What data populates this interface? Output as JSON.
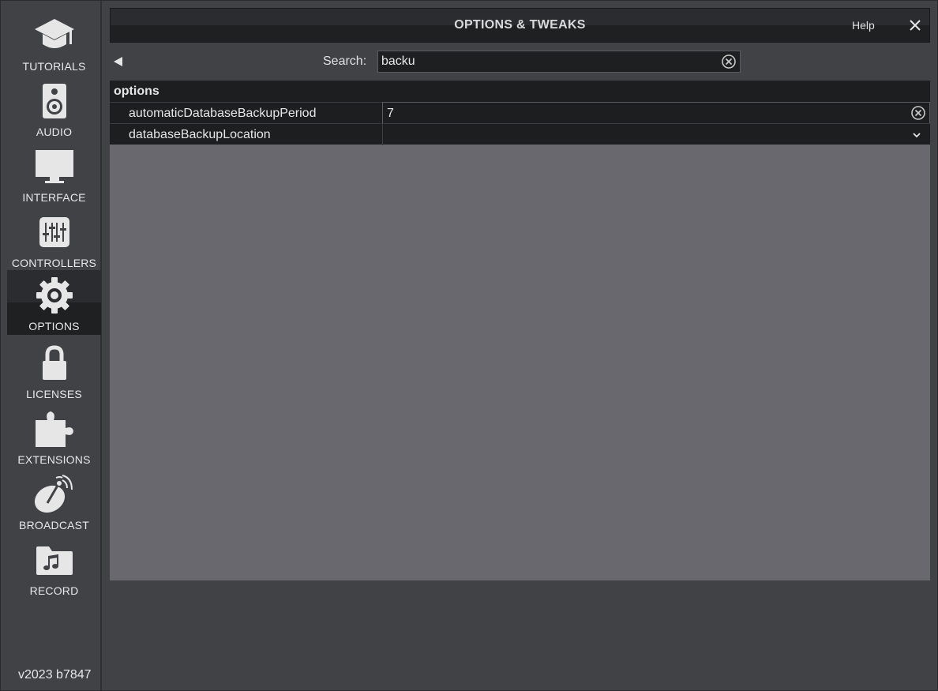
{
  "window": {
    "title": "OPTIONS & TWEAKS",
    "help_label": "Help",
    "close_icon": "close-icon"
  },
  "sidebar": {
    "items": [
      {
        "label": "TUTORIALS",
        "icon": "graduation-cap-icon",
        "active": false
      },
      {
        "label": "AUDIO",
        "icon": "speaker-icon",
        "active": false
      },
      {
        "label": "INTERFACE",
        "icon": "monitor-icon",
        "active": false
      },
      {
        "label": "CONTROLLERS",
        "icon": "sliders-icon",
        "active": false
      },
      {
        "label": "OPTIONS",
        "icon": "gear-icon",
        "active": true
      },
      {
        "label": "LICENSES",
        "icon": "lock-icon",
        "active": false
      },
      {
        "label": "EXTENSIONS",
        "icon": "puzzle-icon",
        "active": false
      },
      {
        "label": "BROADCAST",
        "icon": "satellite-dish-icon",
        "active": false
      },
      {
        "label": "RECORD",
        "icon": "music-folder-icon",
        "active": false
      }
    ],
    "version": "v2023 b7847"
  },
  "search": {
    "label": "Search:",
    "value": "backu"
  },
  "results": {
    "section": "options",
    "rows": [
      {
        "name": "automaticDatabaseBackupPeriod",
        "value": "7",
        "control": "clear"
      },
      {
        "name": "databaseBackupLocation",
        "value": "",
        "control": "dropdown"
      }
    ]
  },
  "colors": {
    "background": "#414246",
    "panel": "#69686e",
    "row": "#1d1e20",
    "icon": "#e6e6e6"
  }
}
